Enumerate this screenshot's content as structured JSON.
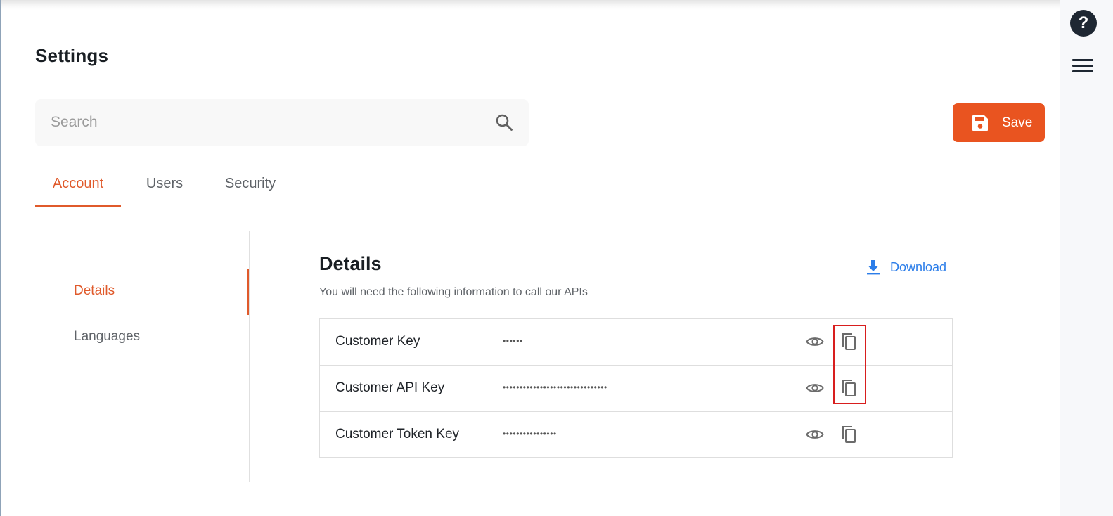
{
  "header": {
    "title": "Settings",
    "help_icon_label": "?",
    "menu_icon": "hamburger-menu-icon"
  },
  "search": {
    "placeholder": "Search",
    "value": "",
    "icon": "search-icon"
  },
  "toolbar": {
    "save_label": "Save",
    "save_icon": "floppy-disk-icon"
  },
  "tabs": [
    {
      "label": "Account",
      "active": true
    },
    {
      "label": "Users",
      "active": false
    },
    {
      "label": "Security",
      "active": false
    }
  ],
  "sidebar": {
    "items": [
      {
        "label": "Details",
        "active": true
      },
      {
        "label": "Languages",
        "active": false
      }
    ]
  },
  "details": {
    "title": "Details",
    "description": "You will need the following information to call our APIs",
    "download_label": "Download",
    "download_icon": "download-icon",
    "rows": [
      {
        "label": "Customer Key",
        "masked_value": "••••••",
        "actions": [
          "eye-icon",
          "copy-icon"
        ]
      },
      {
        "label": "Customer API Key",
        "masked_value": "•••••••••••••••••••••••••••••••",
        "actions": [
          "eye-icon",
          "copy-icon"
        ]
      },
      {
        "label": "Customer Token Key",
        "masked_value": "••••••••••••••••",
        "actions": [
          "eye-icon",
          "copy-icon"
        ]
      }
    ]
  },
  "colors": {
    "accent": "#e05a2b",
    "save_button": "#e95420",
    "link": "#2b7de9",
    "highlight_annotation": "#d81e1e",
    "dark": "#1e2732"
  }
}
